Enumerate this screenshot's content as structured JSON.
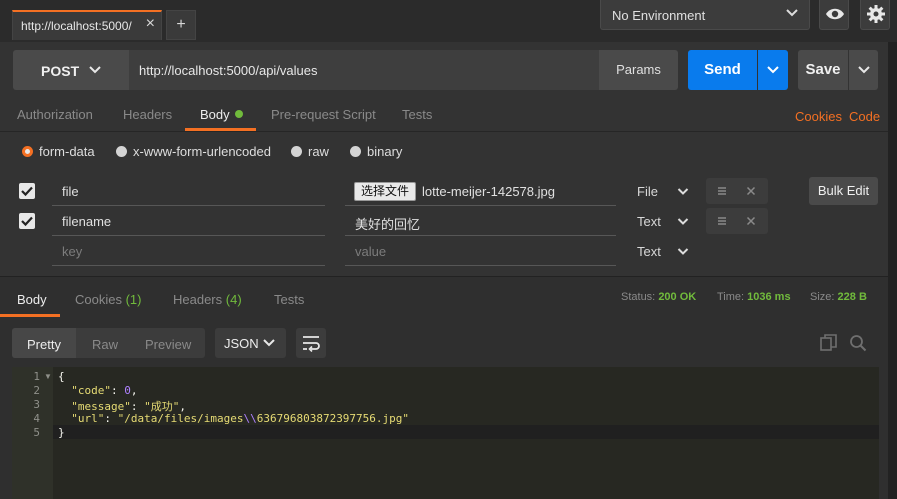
{
  "top": {
    "tab_title": "http://localhost:5000/",
    "tab_close": "×",
    "add_tab": "+",
    "environment": "No Environment",
    "icons": [
      "eye-icon",
      "gear-icon"
    ]
  },
  "request": {
    "method": "POST",
    "url": "http://localhost:5000/api/values",
    "params_label": "Params",
    "send_label": "Send",
    "save_label": "Save"
  },
  "req_tabs": {
    "authorization": "Authorization",
    "headers": "Headers",
    "body": "Body",
    "prerequest": "Pre-request Script",
    "tests": "Tests",
    "cookies": "Cookies",
    "code": "Code"
  },
  "body_types": {
    "form_data": "form-data",
    "urlencoded": "x-www-form-urlencoded",
    "raw": "raw",
    "binary": "binary",
    "selected": "form-data"
  },
  "form_rows": [
    {
      "key": "file",
      "file_button": "选择文件",
      "value": "lotte-meijer-142578.jpg",
      "type": "File",
      "checked": true
    },
    {
      "key": "filename",
      "value": "美好的回忆",
      "type": "Text",
      "checked": true
    },
    {
      "key_placeholder": "key",
      "value_placeholder": "value",
      "type": "Text"
    }
  ],
  "bulk_edit": "Bulk Edit",
  "response": {
    "tabs": {
      "body": "Body",
      "cookies": "Cookies",
      "cookies_count": "(1)",
      "headers": "Headers",
      "headers_count": "(4)",
      "tests": "Tests"
    },
    "status_label": "Status:",
    "status_value": "200 OK",
    "time_label": "Time:",
    "time_value": "1036 ms",
    "size_label": "Size:",
    "size_value": "228 B",
    "views": {
      "pretty": "Pretty",
      "raw": "Raw",
      "preview": "Preview"
    },
    "format": "JSON",
    "line_numbers": [
      "1",
      "2",
      "3",
      "4",
      "5"
    ],
    "code": {
      "open": "{",
      "code_key": "\"code\"",
      "code_val": "0",
      "message_key": "\"message\"",
      "message_val": "\"成功\"",
      "url_key": "\"url\"",
      "url_val_a": "\"/data/files/images",
      "url_escape": "\\\\",
      "url_val_b": "636796803872397756.jpg\"",
      "close": "}"
    }
  },
  "colors": {
    "accent": "#f47023",
    "send": "#097bed",
    "success": "#71bb3c"
  }
}
